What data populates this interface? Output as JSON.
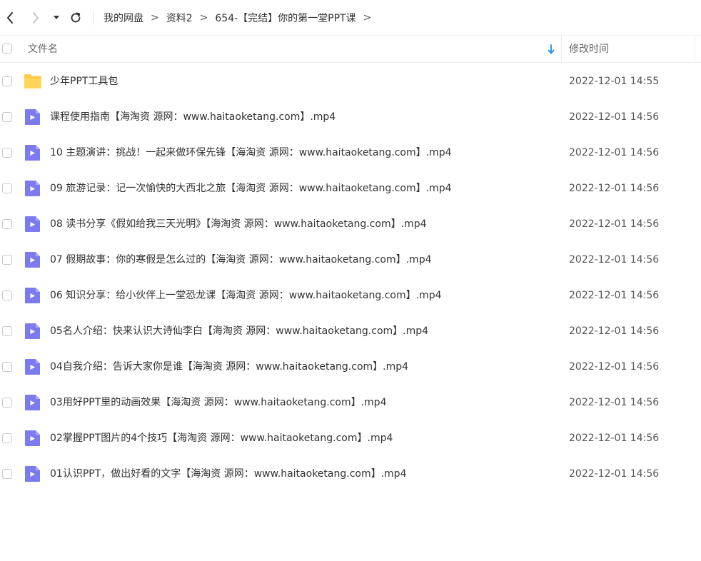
{
  "toolbar": {
    "breadcrumb": [
      "我的网盘",
      "资料2",
      "654-【完结】你的第一堂PPT课"
    ],
    "separator": ">"
  },
  "header": {
    "name_label": "文件名",
    "time_label": "修改时间"
  },
  "colors": {
    "folder": "#FBCB47",
    "video": "#7B7BEF",
    "sort_arrow": "#1E8FE8"
  },
  "files": [
    {
      "type": "folder",
      "name": "少年PPT工具包",
      "modified": "2022-12-01 14:55"
    },
    {
      "type": "video",
      "name": "课程使用指南【海淘资 源网：www.haitaoketang.com】.mp4",
      "modified": "2022-12-01 14:56"
    },
    {
      "type": "video",
      "name": "10 主题演讲：挑战！一起来做环保先锋【海淘资 源网：www.haitaoketang.com】.mp4",
      "modified": "2022-12-01 14:56"
    },
    {
      "type": "video",
      "name": "09 旅游记录：记一次愉快的大西北之旅【海淘资 源网：www.haitaoketang.com】.mp4",
      "modified": "2022-12-01 14:56"
    },
    {
      "type": "video",
      "name": "08 读书分享《假如给我三天光明》【海淘资 源网：www.haitaoketang.com】.mp4",
      "modified": "2022-12-01 14:56"
    },
    {
      "type": "video",
      "name": "07 假期故事：你的寒假是怎么过的【海淘资 源网：www.haitaoketang.com】.mp4",
      "modified": "2022-12-01 14:56"
    },
    {
      "type": "video",
      "name": "06 知识分享：给小伙伴上一堂恐龙课【海淘资 源网：www.haitaoketang.com】.mp4",
      "modified": "2022-12-01 14:56"
    },
    {
      "type": "video",
      "name": "05名人介绍：快来认识大诗仙李白【海淘资 源网：www.haitaoketang.com】.mp4",
      "modified": "2022-12-01 14:56"
    },
    {
      "type": "video",
      "name": "04自我介绍：告诉大家你是谁【海淘资 源网：www.haitaoketang.com】.mp4",
      "modified": "2022-12-01 14:56"
    },
    {
      "type": "video",
      "name": "03用好PPT里的动画效果【海淘资 源网：www.haitaoketang.com】.mp4",
      "modified": "2022-12-01 14:56"
    },
    {
      "type": "video",
      "name": "02掌握PPT图片的4个技巧【海淘资 源网：www.haitaoketang.com】.mp4",
      "modified": "2022-12-01 14:56"
    },
    {
      "type": "video",
      "name": "01认识PPT，做出好看的文字【海淘资 源网：www.haitaoketang.com】.mp4",
      "modified": "2022-12-01 14:56"
    }
  ]
}
